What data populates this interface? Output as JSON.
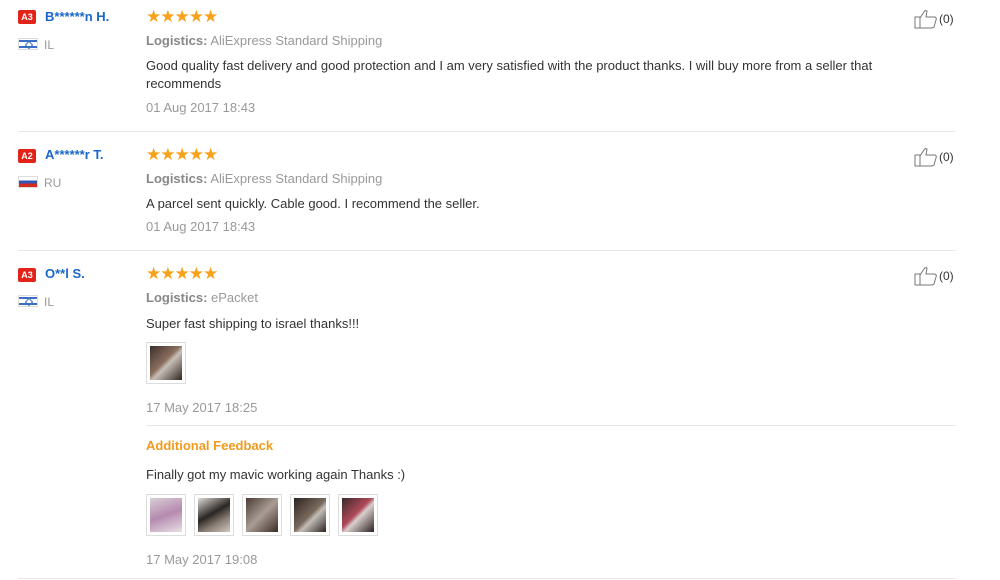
{
  "reviews": [
    {
      "badge": "A3",
      "name": "B******n H.",
      "country": "IL",
      "flag": "il",
      "stars": "★★★★★",
      "logistics_label": "Logistics:",
      "logistics": "AliExpress Standard Shipping",
      "text": "Good quality fast delivery and good protection and I am very satisfied with the product thanks. I will buy more from a seller that recommends",
      "date": "01 Aug 2017 18:43",
      "likes": "(0)"
    },
    {
      "badge": "A2",
      "name": "A******r T.",
      "country": "RU",
      "flag": "ru",
      "stars": "★★★★★",
      "logistics_label": "Logistics:",
      "logistics": "AliExpress Standard Shipping",
      "text": "A parcel sent quickly. Cable good. I recommend the seller.",
      "date": "01 Aug 2017 18:43",
      "likes": "(0)"
    },
    {
      "badge": "A3",
      "name": "O**l S.",
      "country": "IL",
      "flag": "il",
      "stars": "★★★★★",
      "logistics_label": "Logistics:",
      "logistics": "ePacket",
      "text": "Super fast shipping to israel thanks!!!",
      "date": "17 May 2017 18:25",
      "likes": "(0)",
      "additional": {
        "title": "Additional Feedback",
        "text": "Finally got my mavic working again Thanks :)",
        "date": "17 May 2017 19:08"
      }
    }
  ],
  "colors": {
    "accent_orange": "#f29a1e",
    "star": "#f7a21a",
    "name_blue": "#1a66c8",
    "badge_red": "#e2231a"
  },
  "icons": {
    "like": "thumbs-up-icon"
  }
}
